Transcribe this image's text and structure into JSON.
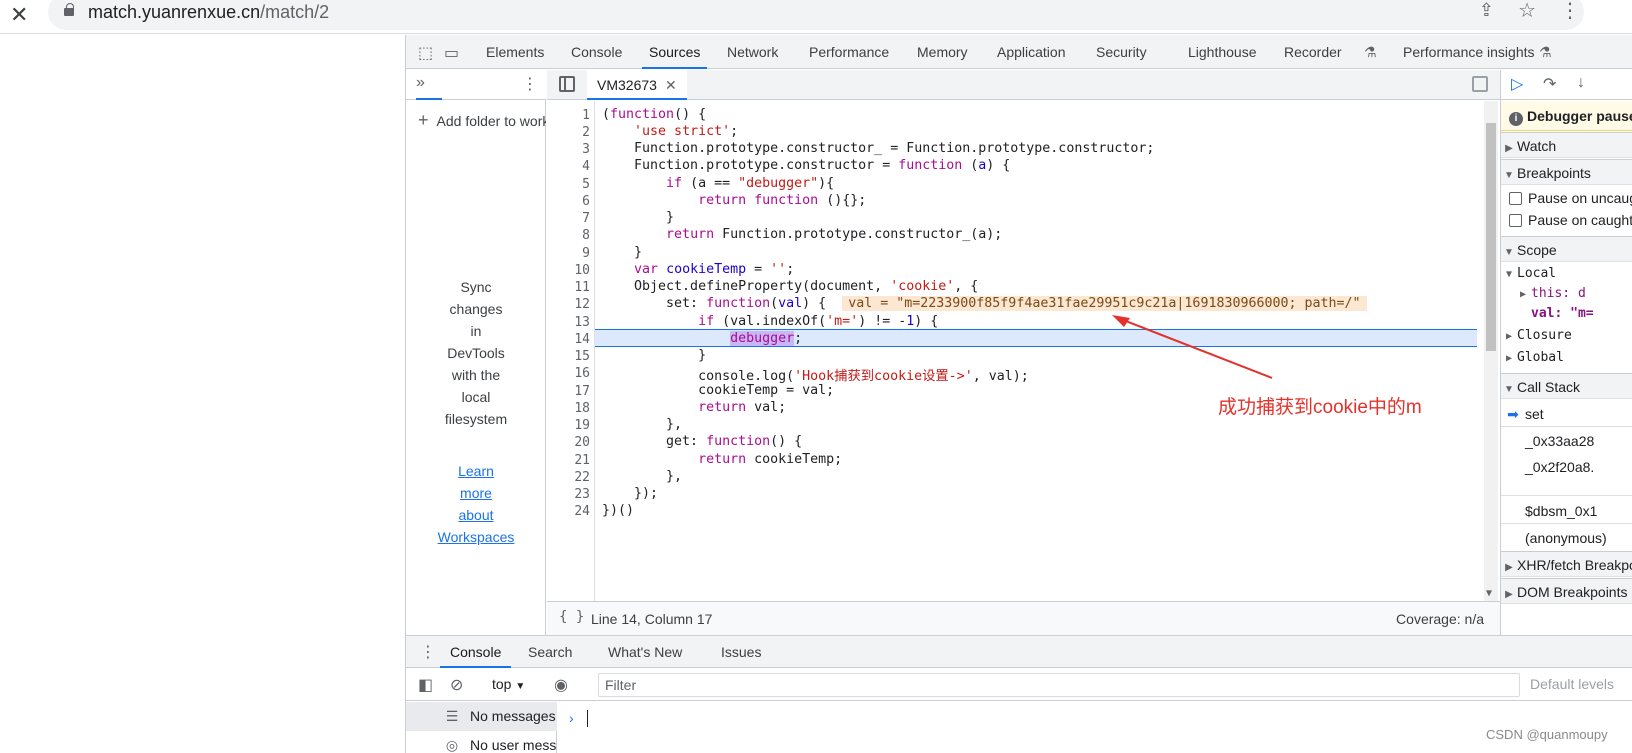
{
  "browser": {
    "url_host": "match.yuanrenxue.cn",
    "url_path": "/match/2"
  },
  "devtools": {
    "tabs": [
      "Elements",
      "Console",
      "Sources",
      "Network",
      "Performance",
      "Memory",
      "Application",
      "Security",
      "Lighthouse",
      "Recorder",
      "Performance insights"
    ],
    "active_tab": "Sources",
    "navigator": {
      "add_folder": "Add folder to workspace",
      "sync_lines": [
        "Sync",
        "changes",
        "in",
        "DevTools",
        "with the",
        "local",
        "filesystem"
      ],
      "learn_lines": [
        "Learn",
        "more",
        "about",
        "Workspaces"
      ]
    },
    "editor": {
      "file_tab": "VM32673",
      "line_numbers": [
        "1",
        "2",
        "3",
        "4",
        "5",
        "6",
        "7",
        "8",
        "9",
        "10",
        "11",
        "12",
        "13",
        "14",
        "15",
        "16",
        "17",
        "18",
        "19",
        "20",
        "21",
        "22",
        "23",
        "24"
      ],
      "inline_value": "val = \"m=2233900f85f9f4ae31fae29951c9c21a|1691830966000; path=/\"",
      "status_position": "Line 14, Column 17",
      "coverage": "Coverage: n/a",
      "current_line": 14
    },
    "debugger": {
      "paused": "Debugger paused",
      "watch": "Watch",
      "breakpoints": "Breakpoints",
      "pause_uncaught": "Pause on uncaught exceptions",
      "pause_caught": "Pause on caught exceptions",
      "scope": "Scope",
      "local": "Local",
      "this_label": "this: d",
      "val_label": "val: \"m=",
      "closure": "Closure",
      "global": "Global",
      "call_stack": "Call Stack",
      "stack": [
        "set",
        "_0x33aa28",
        "_0x2f20a8.",
        "$dbsm_0x1",
        "(anonymous)"
      ],
      "xhr": "XHR/fetch Breakpoints",
      "dom": "DOM Breakpoints"
    },
    "drawer": {
      "tabs": [
        "Console",
        "Search",
        "What's New",
        "Issues"
      ],
      "active": "Console",
      "context": "top",
      "filter_placeholder": "Filter",
      "levels": "Default levels",
      "messages": "No messages",
      "user_messages": "No user messages"
    }
  },
  "annotation": "成功捕获到cookie中的m",
  "watermark": "CSDN @quanmoupy",
  "colors": {
    "accent": "#1a73e8",
    "annotation": "#e5312b",
    "keyword": "#aa0d91",
    "string": "#c41a16"
  }
}
